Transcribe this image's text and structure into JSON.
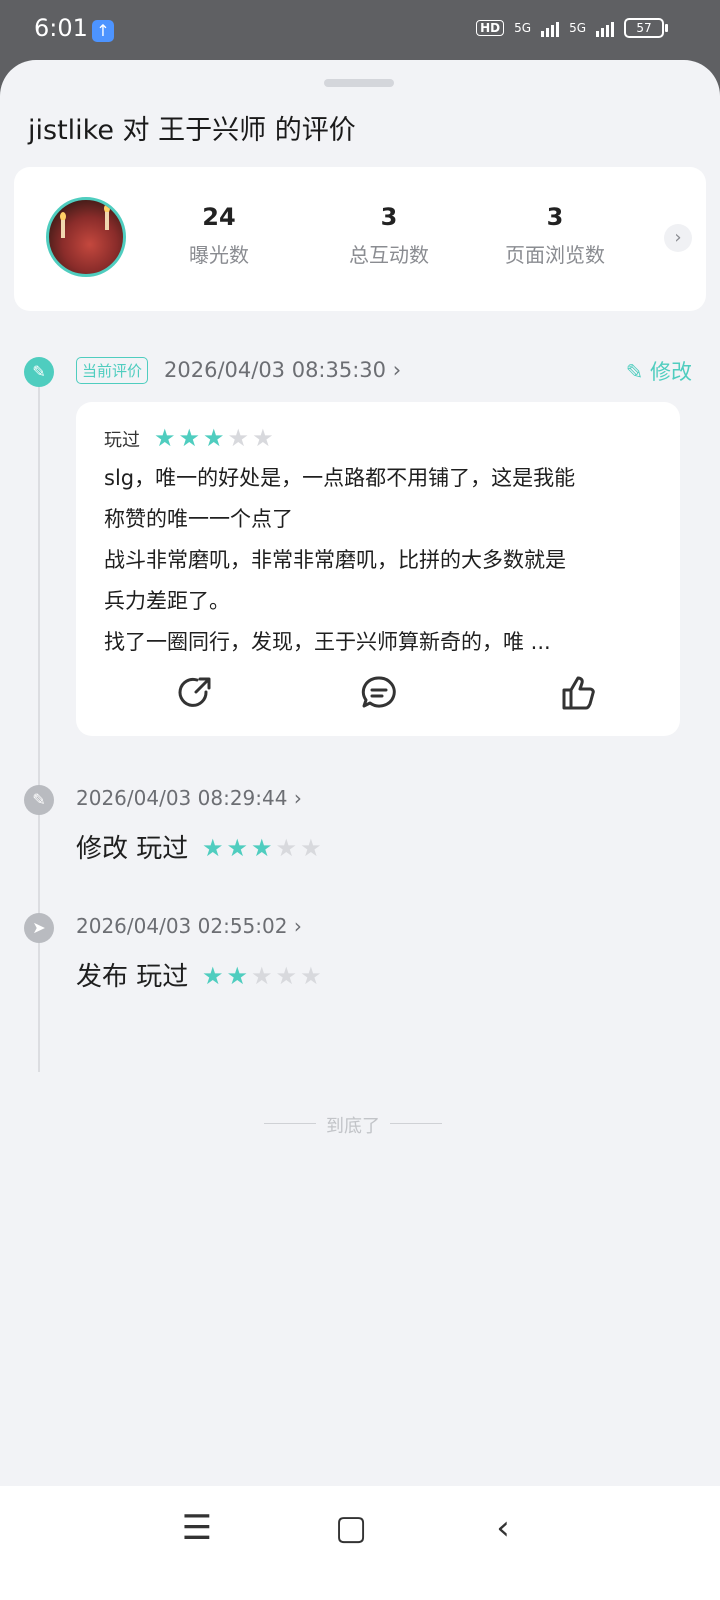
{
  "status": {
    "time": "6:01",
    "hd": "HD",
    "net1": "5G",
    "net2": "5G",
    "battery": "57"
  },
  "header": {
    "title": "jistlike 对 王于兴师 的评价"
  },
  "stats": [
    {
      "value": "24",
      "label": "曝光数"
    },
    {
      "value": "3",
      "label": "总互动数"
    },
    {
      "value": "3",
      "label": "页面浏览数"
    }
  ],
  "current": {
    "badge": "当前评价",
    "date": "2026/04/03 08:35:30",
    "edit_label": "修改",
    "played": "玩过",
    "rating": 3,
    "lines": [
      "slg，唯一的好处是，一点路都不用铺了，这是我能",
      "称赞的唯一一个点了",
      "战斗非常磨叽，非常非常磨叽，比拼的大多数就是",
      "兵力差距了。",
      "找了一圈同行，发现，王于兴师算新奇的，唯 ..."
    ]
  },
  "history": [
    {
      "date": "2026/04/03 08:29:44",
      "action": "修改 玩过",
      "rating": 3
    },
    {
      "date": "2026/04/03 02:55:02",
      "action": "发布 玩过",
      "rating": 2
    }
  ],
  "end_text": "到底了",
  "colors": {
    "accent": "#4fcdbf",
    "star_off": "#d8d9dd"
  },
  "icons": {
    "share": "share-icon",
    "comment": "comment-icon",
    "like": "thumbs-up-icon"
  }
}
